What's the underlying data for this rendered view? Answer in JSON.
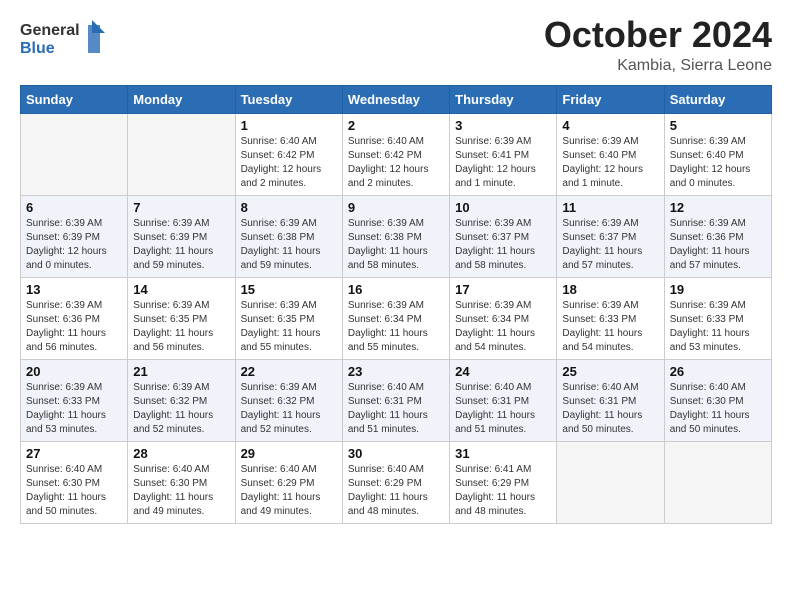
{
  "header": {
    "logo_general": "General",
    "logo_blue": "Blue",
    "month": "October 2024",
    "location": "Kambia, Sierra Leone"
  },
  "weekdays": [
    "Sunday",
    "Monday",
    "Tuesday",
    "Wednesday",
    "Thursday",
    "Friday",
    "Saturday"
  ],
  "weeks": [
    [
      {
        "day": "",
        "info": ""
      },
      {
        "day": "",
        "info": ""
      },
      {
        "day": "1",
        "info": "Sunrise: 6:40 AM\nSunset: 6:42 PM\nDaylight: 12 hours and 2 minutes."
      },
      {
        "day": "2",
        "info": "Sunrise: 6:40 AM\nSunset: 6:42 PM\nDaylight: 12 hours and 2 minutes."
      },
      {
        "day": "3",
        "info": "Sunrise: 6:39 AM\nSunset: 6:41 PM\nDaylight: 12 hours and 1 minute."
      },
      {
        "day": "4",
        "info": "Sunrise: 6:39 AM\nSunset: 6:40 PM\nDaylight: 12 hours and 1 minute."
      },
      {
        "day": "5",
        "info": "Sunrise: 6:39 AM\nSunset: 6:40 PM\nDaylight: 12 hours and 0 minutes."
      }
    ],
    [
      {
        "day": "6",
        "info": "Sunrise: 6:39 AM\nSunset: 6:39 PM\nDaylight: 12 hours and 0 minutes."
      },
      {
        "day": "7",
        "info": "Sunrise: 6:39 AM\nSunset: 6:39 PM\nDaylight: 11 hours and 59 minutes."
      },
      {
        "day": "8",
        "info": "Sunrise: 6:39 AM\nSunset: 6:38 PM\nDaylight: 11 hours and 59 minutes."
      },
      {
        "day": "9",
        "info": "Sunrise: 6:39 AM\nSunset: 6:38 PM\nDaylight: 11 hours and 58 minutes."
      },
      {
        "day": "10",
        "info": "Sunrise: 6:39 AM\nSunset: 6:37 PM\nDaylight: 11 hours and 58 minutes."
      },
      {
        "day": "11",
        "info": "Sunrise: 6:39 AM\nSunset: 6:37 PM\nDaylight: 11 hours and 57 minutes."
      },
      {
        "day": "12",
        "info": "Sunrise: 6:39 AM\nSunset: 6:36 PM\nDaylight: 11 hours and 57 minutes."
      }
    ],
    [
      {
        "day": "13",
        "info": "Sunrise: 6:39 AM\nSunset: 6:36 PM\nDaylight: 11 hours and 56 minutes."
      },
      {
        "day": "14",
        "info": "Sunrise: 6:39 AM\nSunset: 6:35 PM\nDaylight: 11 hours and 56 minutes."
      },
      {
        "day": "15",
        "info": "Sunrise: 6:39 AM\nSunset: 6:35 PM\nDaylight: 11 hours and 55 minutes."
      },
      {
        "day": "16",
        "info": "Sunrise: 6:39 AM\nSunset: 6:34 PM\nDaylight: 11 hours and 55 minutes."
      },
      {
        "day": "17",
        "info": "Sunrise: 6:39 AM\nSunset: 6:34 PM\nDaylight: 11 hours and 54 minutes."
      },
      {
        "day": "18",
        "info": "Sunrise: 6:39 AM\nSunset: 6:33 PM\nDaylight: 11 hours and 54 minutes."
      },
      {
        "day": "19",
        "info": "Sunrise: 6:39 AM\nSunset: 6:33 PM\nDaylight: 11 hours and 53 minutes."
      }
    ],
    [
      {
        "day": "20",
        "info": "Sunrise: 6:39 AM\nSunset: 6:33 PM\nDaylight: 11 hours and 53 minutes."
      },
      {
        "day": "21",
        "info": "Sunrise: 6:39 AM\nSunset: 6:32 PM\nDaylight: 11 hours and 52 minutes."
      },
      {
        "day": "22",
        "info": "Sunrise: 6:39 AM\nSunset: 6:32 PM\nDaylight: 11 hours and 52 minutes."
      },
      {
        "day": "23",
        "info": "Sunrise: 6:40 AM\nSunset: 6:31 PM\nDaylight: 11 hours and 51 minutes."
      },
      {
        "day": "24",
        "info": "Sunrise: 6:40 AM\nSunset: 6:31 PM\nDaylight: 11 hours and 51 minutes."
      },
      {
        "day": "25",
        "info": "Sunrise: 6:40 AM\nSunset: 6:31 PM\nDaylight: 11 hours and 50 minutes."
      },
      {
        "day": "26",
        "info": "Sunrise: 6:40 AM\nSunset: 6:30 PM\nDaylight: 11 hours and 50 minutes."
      }
    ],
    [
      {
        "day": "27",
        "info": "Sunrise: 6:40 AM\nSunset: 6:30 PM\nDaylight: 11 hours and 50 minutes."
      },
      {
        "day": "28",
        "info": "Sunrise: 6:40 AM\nSunset: 6:30 PM\nDaylight: 11 hours and 49 minutes."
      },
      {
        "day": "29",
        "info": "Sunrise: 6:40 AM\nSunset: 6:29 PM\nDaylight: 11 hours and 49 minutes."
      },
      {
        "day": "30",
        "info": "Sunrise: 6:40 AM\nSunset: 6:29 PM\nDaylight: 11 hours and 48 minutes."
      },
      {
        "day": "31",
        "info": "Sunrise: 6:41 AM\nSunset: 6:29 PM\nDaylight: 11 hours and 48 minutes."
      },
      {
        "day": "",
        "info": ""
      },
      {
        "day": "",
        "info": ""
      }
    ]
  ]
}
